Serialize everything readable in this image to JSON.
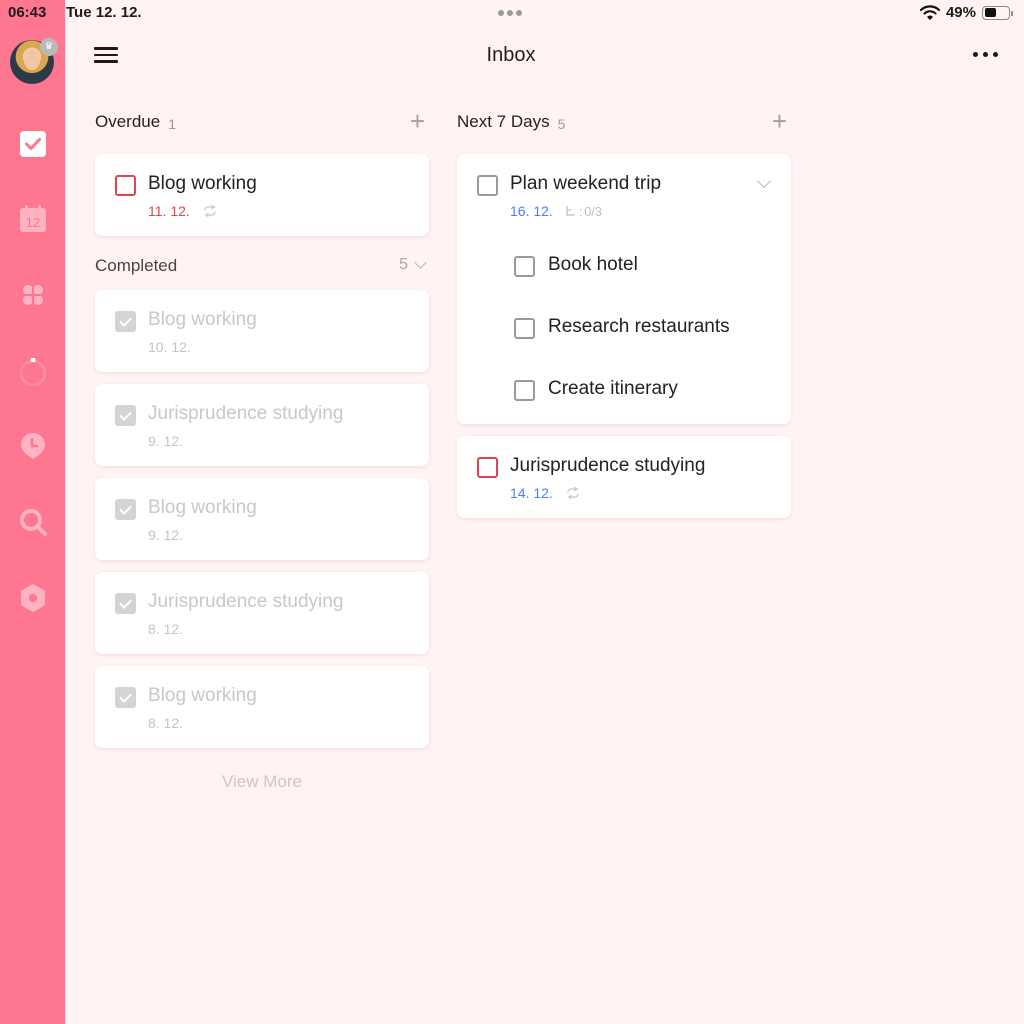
{
  "status_bar": {
    "time": "06:43",
    "date": "Tue 12. 12.",
    "battery": "49%",
    "battery_level": 0.49,
    "wifi_icon": "wifi-icon"
  },
  "sidebar": {
    "avatar_badge_icon": "crown-icon",
    "items": [
      {
        "name": "tasks",
        "icon": "checkbox-icon",
        "active": true
      },
      {
        "name": "calendar",
        "icon": "calendar-icon",
        "label": "12"
      },
      {
        "name": "matrix",
        "icon": "clover-icon"
      },
      {
        "name": "pomodoro",
        "icon": "pomodoro-timer-icon"
      },
      {
        "name": "habit",
        "icon": "clock-pin-icon"
      },
      {
        "name": "search",
        "icon": "search-icon"
      },
      {
        "name": "settings",
        "icon": "hexagon-settings-icon"
      }
    ]
  },
  "header": {
    "title": "Inbox",
    "menu_icon": "hamburger-menu-icon",
    "more_icon": "more-horizontal-icon"
  },
  "overdue": {
    "title": "Overdue",
    "count": "1",
    "tasks": [
      {
        "title": "Blog working",
        "date": "11. 12.",
        "repeat": true
      }
    ]
  },
  "completed": {
    "title": "Completed",
    "count": "5",
    "tasks": [
      {
        "title": "Blog working",
        "date": "10. 12."
      },
      {
        "title": "Jurisprudence studying",
        "date": "9. 12."
      },
      {
        "title": "Blog working",
        "date": "9. 12."
      },
      {
        "title": "Jurisprudence studying",
        "date": "8. 12."
      },
      {
        "title": "Blog working",
        "date": "8. 12."
      }
    ],
    "view_more": "View More"
  },
  "next7": {
    "title": "Next 7 Days",
    "count": "5",
    "tasks": [
      {
        "title": "Plan weekend trip",
        "date": "16. 12.",
        "subtask_progress": "0/3",
        "subtasks": [
          "Book hotel",
          "Research restaurants",
          "Create itinerary"
        ]
      },
      {
        "title": "Jurisprudence studying",
        "date": "14. 12.",
        "repeat": true
      }
    ]
  },
  "colors": {
    "sidebar": "#ff7691",
    "background": "#fff3f4",
    "overdue_red": "#e0454d",
    "date_blue": "#4b7ff5",
    "completed_grey": "#c8c8c8"
  }
}
